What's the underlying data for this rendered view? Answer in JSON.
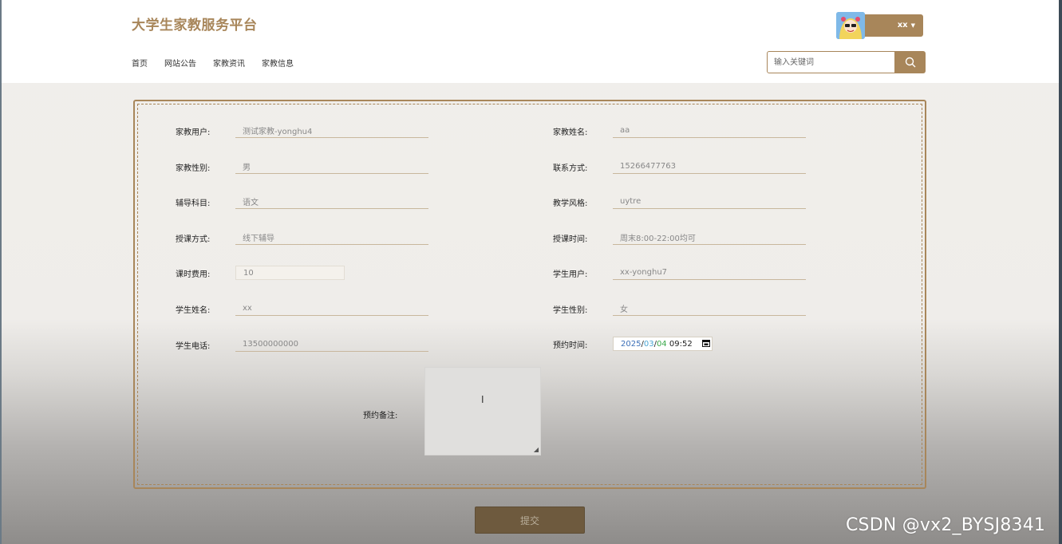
{
  "header": {
    "site_title": "大学生家教服务平台",
    "nav": [
      "首页",
      "网站公告",
      "家教资讯",
      "家教信息"
    ],
    "user_label": "xx",
    "search_placeholder": "输入关键词"
  },
  "form": {
    "fields_left": [
      {
        "label": "家教用户:",
        "value": "测试家教-yonghu4"
      },
      {
        "label": "家教性别:",
        "value": "男"
      },
      {
        "label": "辅导科目:",
        "value": "语文"
      },
      {
        "label": "授课方式:",
        "value": "线下辅导"
      },
      {
        "label": "课时费用:",
        "value": "10"
      },
      {
        "label": "学生姓名:",
        "value": "xx"
      },
      {
        "label": "学生电话:",
        "value": "13500000000"
      }
    ],
    "fields_right": [
      {
        "label": "家教姓名:",
        "value": "aa"
      },
      {
        "label": "联系方式:",
        "value": "15266477763"
      },
      {
        "label": "教学风格:",
        "value": "uytre"
      },
      {
        "label": "授课时间:",
        "value": "周末8:00-22:00均可"
      },
      {
        "label": "学生用户:",
        "value": "xx-yonghu7"
      },
      {
        "label": "学生性别:",
        "value": "女"
      }
    ],
    "date_field": {
      "label": "预约时间:",
      "year": "2025",
      "month": "03",
      "day": "04",
      "time": "09:52"
    },
    "remark_label": "预约备注:",
    "submit_label": "提交"
  },
  "watermark": "CSDN @vx2_BYSJ8341",
  "colors": {
    "accent": "#a8865a",
    "submit": "#6e5a3e"
  }
}
